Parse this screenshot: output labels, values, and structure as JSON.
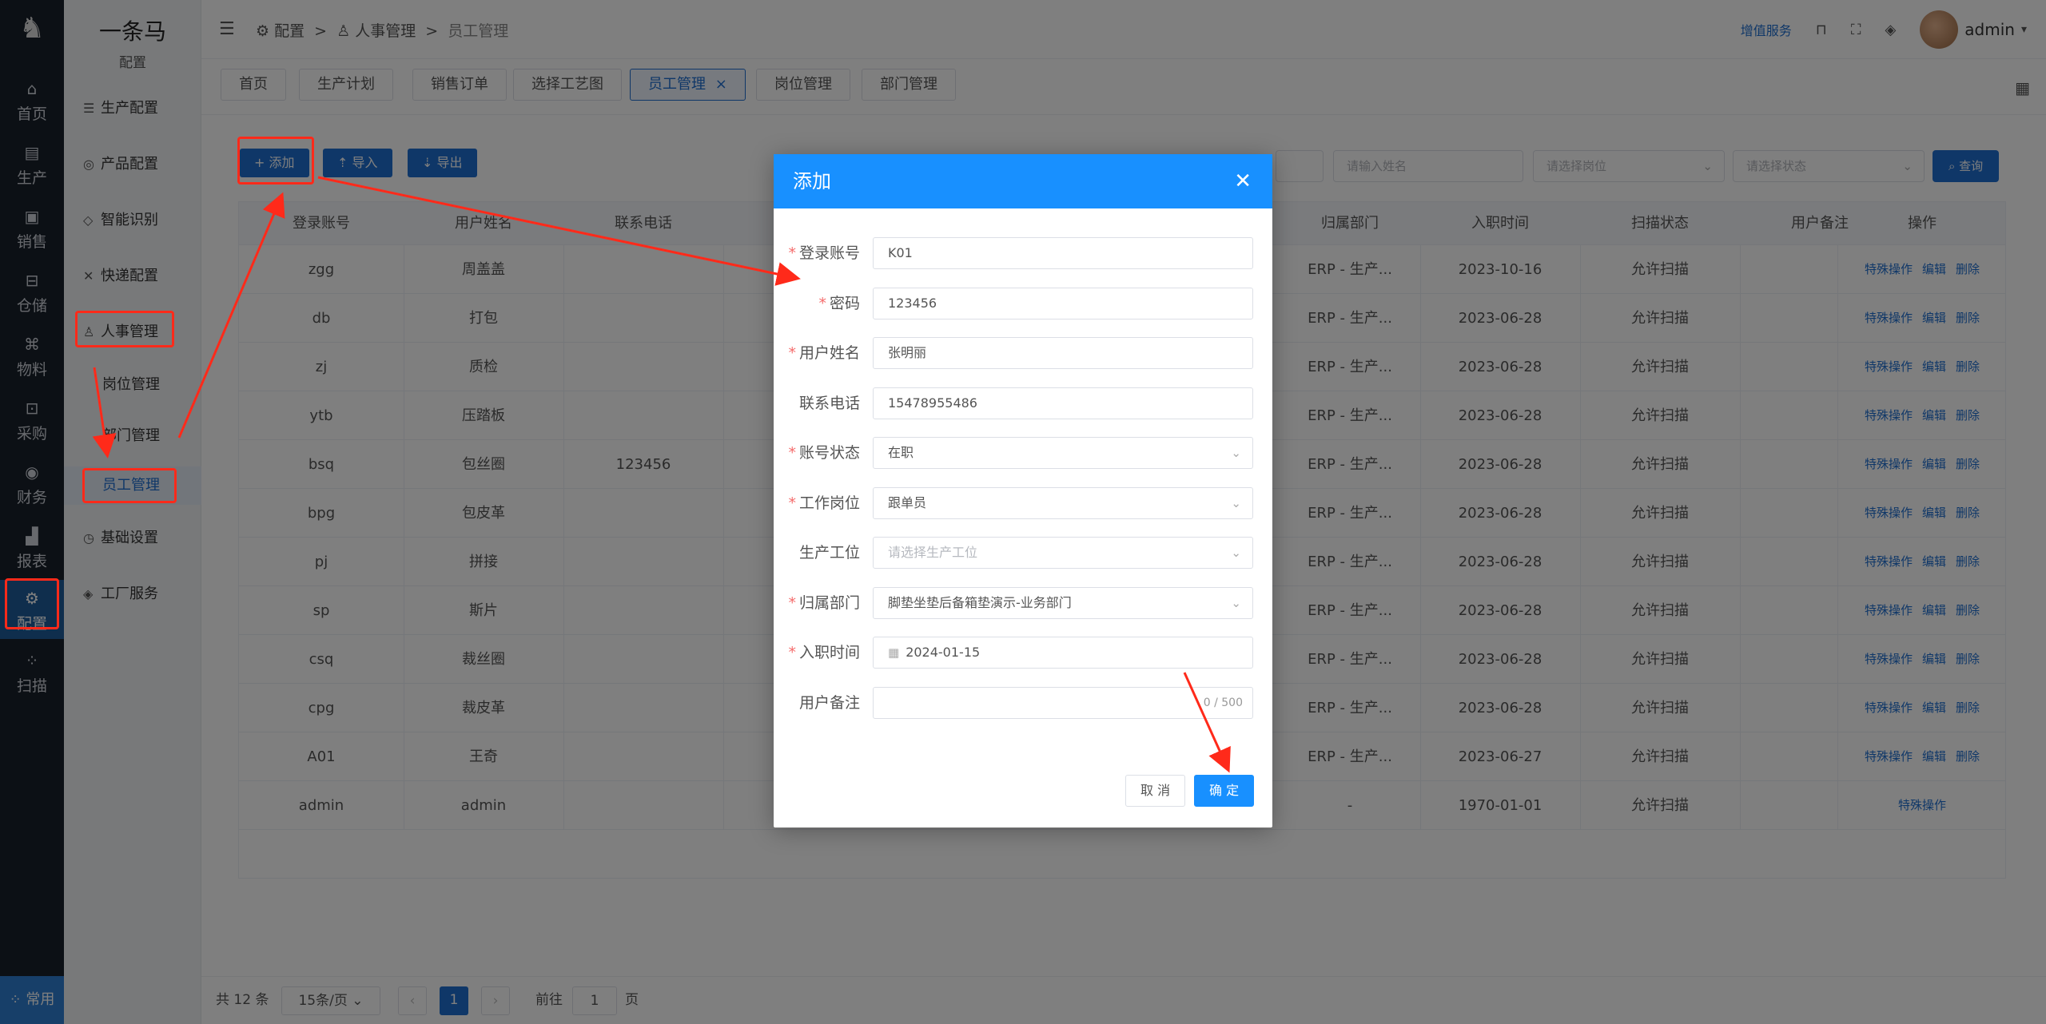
{
  "rail": {
    "items": [
      {
        "label": "首页",
        "icon": "home-icon",
        "glyph": "⌂"
      },
      {
        "label": "生产",
        "icon": "production-icon",
        "glyph": "▤"
      },
      {
        "label": "销售",
        "icon": "sales-icon",
        "glyph": "▣"
      },
      {
        "label": "仓储",
        "icon": "warehouse-icon",
        "glyph": "⊟"
      },
      {
        "label": "物料",
        "icon": "material-icon",
        "glyph": "⌘"
      },
      {
        "label": "采购",
        "icon": "purchase-icon",
        "glyph": "⊡"
      },
      {
        "label": "财务",
        "icon": "finance-icon",
        "glyph": "◉"
      },
      {
        "label": "报表",
        "icon": "report-icon",
        "glyph": "▟"
      },
      {
        "label": "配置",
        "icon": "config-icon",
        "glyph": "⚙"
      },
      {
        "label": "扫描",
        "icon": "scan-icon",
        "glyph": "⁘"
      }
    ],
    "common": "常用"
  },
  "submenu": {
    "brand": "一条马",
    "brand_sub": "配置",
    "items": [
      {
        "label": "生产配置",
        "glyph": "☰"
      },
      {
        "label": "产品配置",
        "glyph": "◎"
      },
      {
        "label": "智能识别",
        "glyph": "◇"
      },
      {
        "label": "快递配置",
        "glyph": "✕"
      },
      {
        "label": "人事管理",
        "glyph": "♙"
      },
      {
        "label": "岗位管理",
        "glyph": ""
      },
      {
        "label": "部门管理",
        "glyph": ""
      },
      {
        "label": "员工管理",
        "glyph": ""
      },
      {
        "label": "基础设置",
        "glyph": "◷"
      },
      {
        "label": "工厂服务",
        "glyph": "◈"
      }
    ]
  },
  "topbar": {
    "crumbs": [
      "配置",
      "人事管理",
      "员工管理"
    ],
    "vip": "增值服务",
    "user": "admin"
  },
  "tabs": [
    "首页",
    "生产计划",
    "销售订单",
    "选择工艺图",
    "员工管理",
    "岗位管理",
    "部门管理"
  ],
  "toolbar": {
    "add": "+ 添加",
    "import": "⇡ 导入",
    "export": "⇣ 导出",
    "name_ph": "请输入姓名",
    "post_ph": "请选择岗位",
    "status_ph": "请选择状态",
    "query": "⌕ 查询"
  },
  "table": {
    "headers": [
      "登录账号",
      "用户姓名",
      "联系电话",
      "归属部门",
      "入职时间",
      "扫描状态",
      "用户备注",
      "操作"
    ],
    "rows": [
      {
        "account": "zgg",
        "name": "周盖盖",
        "phone": "",
        "dept": "ERP - 生产...",
        "date": "2023-10-16",
        "scan": "允许扫描"
      },
      {
        "account": "db",
        "name": "打包",
        "phone": "",
        "dept": "ERP - 生产...",
        "date": "2023-06-28",
        "scan": "允许扫描"
      },
      {
        "account": "zj",
        "name": "质检",
        "phone": "",
        "dept": "ERP - 生产...",
        "date": "2023-06-28",
        "scan": "允许扫描"
      },
      {
        "account": "ytb",
        "name": "压踏板",
        "phone": "",
        "dept": "ERP - 生产...",
        "date": "2023-06-28",
        "scan": "允许扫描"
      },
      {
        "account": "bsq",
        "name": "包丝圈",
        "phone": "123456",
        "dept": "ERP - 生产...",
        "date": "2023-06-28",
        "scan": "允许扫描"
      },
      {
        "account": "bpg",
        "name": "包皮革",
        "phone": "",
        "dept": "ERP - 生产...",
        "date": "2023-06-28",
        "scan": "允许扫描"
      },
      {
        "account": "pj",
        "name": "拼接",
        "phone": "",
        "dept": "ERP - 生产...",
        "date": "2023-06-28",
        "scan": "允许扫描"
      },
      {
        "account": "sp",
        "name": "斯片",
        "phone": "",
        "dept": "ERP - 生产...",
        "date": "2023-06-28",
        "scan": "允许扫描"
      },
      {
        "account": "csq",
        "name": "裁丝圈",
        "phone": "",
        "dept": "ERP - 生产...",
        "date": "2023-06-28",
        "scan": "允许扫描"
      },
      {
        "account": "cpg",
        "name": "裁皮革",
        "phone": "",
        "dept": "ERP - 生产...",
        "date": "2023-06-28",
        "scan": "允许扫描"
      },
      {
        "account": "A01",
        "name": "王奇",
        "phone": "",
        "dept": "ERP - 生产...",
        "date": "2023-06-27",
        "scan": "允许扫描"
      },
      {
        "account": "admin",
        "name": "admin",
        "phone": "",
        "dept": "-",
        "date": "1970-01-01",
        "scan": "允许扫描"
      }
    ],
    "op_special": "特殊操作",
    "op_edit": "编辑",
    "op_delete": "删除"
  },
  "pager": {
    "total": "共 12 条",
    "size": "15条/页",
    "page": "1",
    "goto": "前往",
    "goto_val": "1",
    "unit": "页"
  },
  "modal": {
    "title": "添加",
    "fields": [
      {
        "label": "登录账号",
        "required": true,
        "value": "K01",
        "type": "text"
      },
      {
        "label": "密码",
        "required": true,
        "value": "123456",
        "type": "text"
      },
      {
        "label": "用户姓名",
        "required": true,
        "value": "张明丽",
        "type": "text"
      },
      {
        "label": "联系电话",
        "required": false,
        "value": "15478955486",
        "type": "text"
      },
      {
        "label": "账号状态",
        "required": true,
        "value": "在职",
        "type": "select"
      },
      {
        "label": "工作岗位",
        "required": true,
        "value": "跟单员",
        "type": "select"
      },
      {
        "label": "生产工位",
        "required": false,
        "value": "请选择生产工位",
        "type": "select-ph"
      },
      {
        "label": "归属部门",
        "required": true,
        "value": "脚垫坐垫后备箱垫演示-业务部门",
        "type": "select"
      },
      {
        "label": "入职时间",
        "required": true,
        "value": "2024-01-15",
        "type": "date"
      },
      {
        "label": "用户备注",
        "required": false,
        "value": "",
        "type": "textarea",
        "count": "0 / 500"
      }
    ],
    "cancel": "取 消",
    "ok": "确 定"
  },
  "colors": {
    "primary": "#1f6fd1",
    "modal_header": "#1890ff",
    "annotation": "#ff2a1a",
    "rail_bg": "#19202b"
  }
}
